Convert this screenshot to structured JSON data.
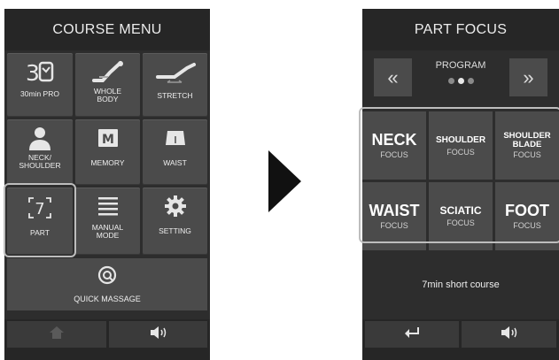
{
  "left": {
    "title": "COURSE MENU",
    "tiles": [
      {
        "label": "30min PRO",
        "icon": "30-minute-icon"
      },
      {
        "label": "WHOLE BODY",
        "icon": "reclining-body-icon"
      },
      {
        "label": "STRETCH",
        "icon": "stretch-icon"
      },
      {
        "label": "NECK/ SHOULDER",
        "icon": "neck-shoulder-icon"
      },
      {
        "label": "MEMORY",
        "icon": "memory-icon"
      },
      {
        "label": "WAIST",
        "icon": "waist-icon"
      },
      {
        "label": "PART",
        "icon": "part-icon"
      },
      {
        "label": "MANUAL MODE",
        "icon": "list-icon"
      },
      {
        "label": "SETTING",
        "icon": "gear-icon"
      }
    ],
    "quick_label": "QUICK MASSAGE",
    "part_glyph": "7",
    "memory_glyph": "M"
  },
  "right": {
    "title": "PART FOCUS",
    "program_label": "PROGRAM",
    "prev_glyph": "«",
    "next_glyph": "»",
    "focus_tiles": [
      {
        "name": "NECK",
        "sub": "FOCUS"
      },
      {
        "name": "SHOULDER",
        "sub": "FOCUS"
      },
      {
        "name": "SHOULDER BLADE",
        "sub": "FOCUS"
      },
      {
        "name": "WAIST",
        "sub": "FOCUS"
      },
      {
        "name": "SCIATIC",
        "sub": "FOCUS"
      },
      {
        "name": "FOOT",
        "sub": "FOCUS"
      }
    ],
    "status": "7min short course"
  },
  "colors": {
    "panel": "#2d2d2d",
    "tile": "#4b4b4b",
    "bar": "#262626",
    "highlight": "#bdbdbd"
  }
}
